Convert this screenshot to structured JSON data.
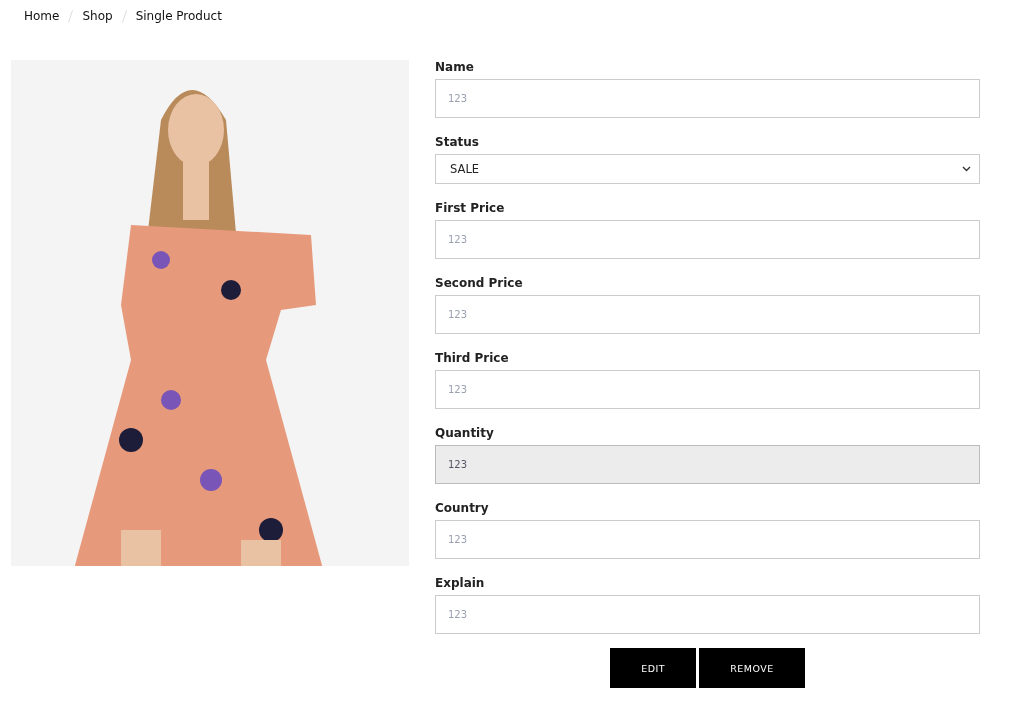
{
  "breadcrumb": [
    {
      "label": "Home"
    },
    {
      "label": "Shop"
    },
    {
      "label": "Single Product"
    }
  ],
  "form": {
    "fields": [
      {
        "kind": "text",
        "label": "Name",
        "placeholder": "123",
        "disabled": false
      },
      {
        "kind": "select",
        "label": "Status",
        "value": "SALE",
        "disabled": false
      },
      {
        "kind": "text",
        "label": "First Price",
        "placeholder": "123",
        "disabled": false
      },
      {
        "kind": "text",
        "label": "Second Price",
        "placeholder": "123",
        "disabled": false
      },
      {
        "kind": "text",
        "label": "Third Price",
        "placeholder": "123",
        "disabled": false
      },
      {
        "kind": "text",
        "label": "Quantity",
        "placeholder": "123",
        "disabled": true
      },
      {
        "kind": "text",
        "label": "Country",
        "placeholder": "123",
        "disabled": false
      },
      {
        "kind": "text",
        "label": "Explain",
        "placeholder": "123",
        "disabled": false
      }
    ],
    "buttons": [
      {
        "label": "EDIT"
      },
      {
        "label": "REMOVE"
      }
    ]
  }
}
